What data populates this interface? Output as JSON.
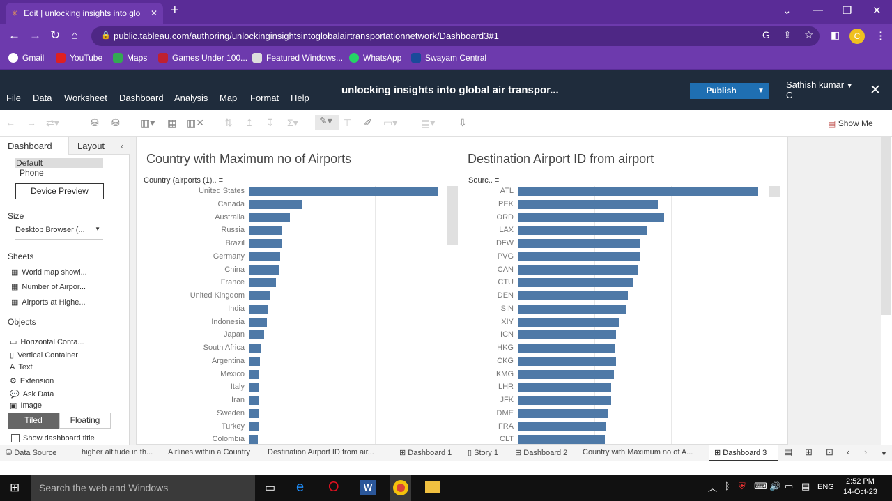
{
  "browser": {
    "tab_title": "Edit | unlocking insights into glo",
    "url": "public.tableau.com/authoring/unlockinginsightsintoglobalairtransportationnetwork/Dashboard3#1",
    "bookmarks": [
      "Gmail",
      "YouTube",
      "Maps",
      "Games Under 100...",
      "Featured Windows...",
      "WhatsApp",
      "Swayam Central"
    ],
    "profile_initial": "C"
  },
  "app": {
    "menus": [
      "File",
      "Data",
      "Worksheet",
      "Dashboard",
      "Analysis",
      "Map",
      "Format",
      "Help"
    ],
    "workbook_title": "unlocking insights into global air transpor...",
    "publish_label": "Publish",
    "user_name": "Sathish kumar",
    "user_initial": "C",
    "show_me": "Show Me"
  },
  "left_panel": {
    "tab_dashboard": "Dashboard",
    "tab_layout": "Layout",
    "devices": [
      "Default",
      "Phone"
    ],
    "device_preview": "Device Preview",
    "size_label": "Size",
    "size_value": "Desktop Browser (...",
    "sheets_label": "Sheets",
    "sheets": [
      "World map showi...",
      "Number of Airpor...",
      "Airports at Highe..."
    ],
    "objects_label": "Objects",
    "objects": [
      "Horizontal Conta...",
      "Vertical Container",
      "Text",
      "Extension",
      "Ask Data",
      "Image"
    ],
    "tiled": "Tiled",
    "floating": "Floating",
    "show_title": "Show dashboard title"
  },
  "chart_data": [
    {
      "type": "bar",
      "title": "Country with Maximum no of Airports",
      "column_header": "Country (airports (1)..",
      "categories": [
        "United States",
        "Canada",
        "Australia",
        "Russia",
        "Brazil",
        "Germany",
        "China",
        "France",
        "United Kingdom",
        "India",
        "Indonesia",
        "Japan",
        "South Africa",
        "Argentina",
        "Mexico",
        "Italy",
        "Iran",
        "Sweden",
        "Turkey",
        "Colombia"
      ],
      "values": [
        1512,
        429,
        329,
        264,
        264,
        249,
        241,
        217,
        167,
        148,
        144,
        123,
        103,
        92,
        86,
        83,
        81,
        80,
        76,
        72
      ]
    },
    {
      "type": "bar",
      "title": "Destination Airport ID from airport",
      "column_header": "Sourc..",
      "categories": [
        "ATL",
        "PEK",
        "ORD",
        "LAX",
        "DFW",
        "PVG",
        "CAN",
        "CTU",
        "DEN",
        "SIN",
        "XIY",
        "ICN",
        "HKG",
        "CKG",
        "KMG",
        "LHR",
        "JFK",
        "DME",
        "FRA",
        "CLT"
      ],
      "values": [
        915,
        535,
        558,
        492,
        469,
        467,
        459,
        440,
        419,
        412,
        386,
        374,
        372,
        374,
        366,
        356,
        356,
        346,
        337,
        333
      ]
    }
  ],
  "sheet_tabs": [
    "Data Source",
    "higher altitude in th...",
    "Airlines within a Country",
    "Destination Airport ID from air...",
    "Dashboard 1",
    "Story 1",
    "Dashboard 2",
    "Country with Maximum no of A...",
    "Dashboard 3"
  ],
  "taskbar": {
    "search": "Search the web and Windows",
    "lang": "ENG",
    "time": "2:52 PM",
    "date": "14-Oct-23"
  }
}
